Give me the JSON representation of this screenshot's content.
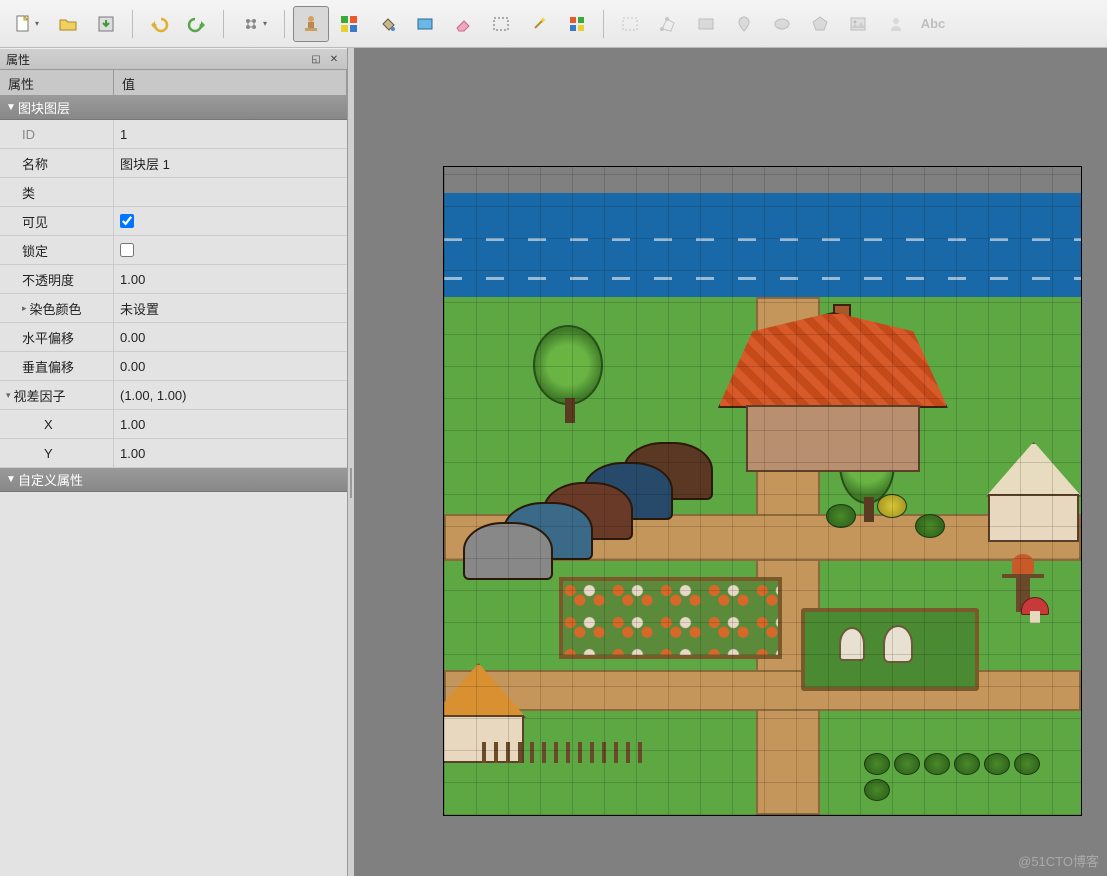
{
  "toolbar": {
    "new": "新建",
    "open": "打开",
    "save": "保存",
    "undo": "撤销",
    "redo": "重做",
    "command": "命令",
    "stamp": "图章",
    "terrain": "地形",
    "bucket": "填充",
    "rect": "矩形",
    "eraser": "橡皮",
    "marquee": "选框",
    "wand": "魔棒",
    "sametile": "相同图块",
    "layers": "图层",
    "objects": "对象",
    "shapes": "形状",
    "point": "点",
    "ellipse": "椭圆",
    "polygon": "多边形",
    "image": "图像",
    "template": "模板",
    "text": "Abc"
  },
  "panel": {
    "title": "属性",
    "col_name": "属性",
    "col_value": "值",
    "section_tile_layer": "图块图层",
    "section_custom": "自定义属性",
    "rows": {
      "id_label": "ID",
      "id_value": "1",
      "name_label": "名称",
      "name_value": "图块层 1",
      "class_label": "类",
      "class_value": "",
      "visible_label": "可见",
      "visible_value": true,
      "locked_label": "锁定",
      "locked_value": false,
      "opacity_label": "不透明度",
      "opacity_value": "1.00",
      "tint_label": "染色颜色",
      "tint_value": "未设置",
      "offsetx_label": "水平偏移",
      "offsetx_value": "0.00",
      "offsety_label": "垂直偏移",
      "offsety_value": "0.00",
      "parallax_label": "视差因子",
      "parallax_value": "(1.00, 1.00)",
      "parallax_x_label": "X",
      "parallax_x_value": "1.00",
      "parallax_y_label": "Y",
      "parallax_y_value": "1.00"
    }
  },
  "watermark": "@51CTO博客"
}
